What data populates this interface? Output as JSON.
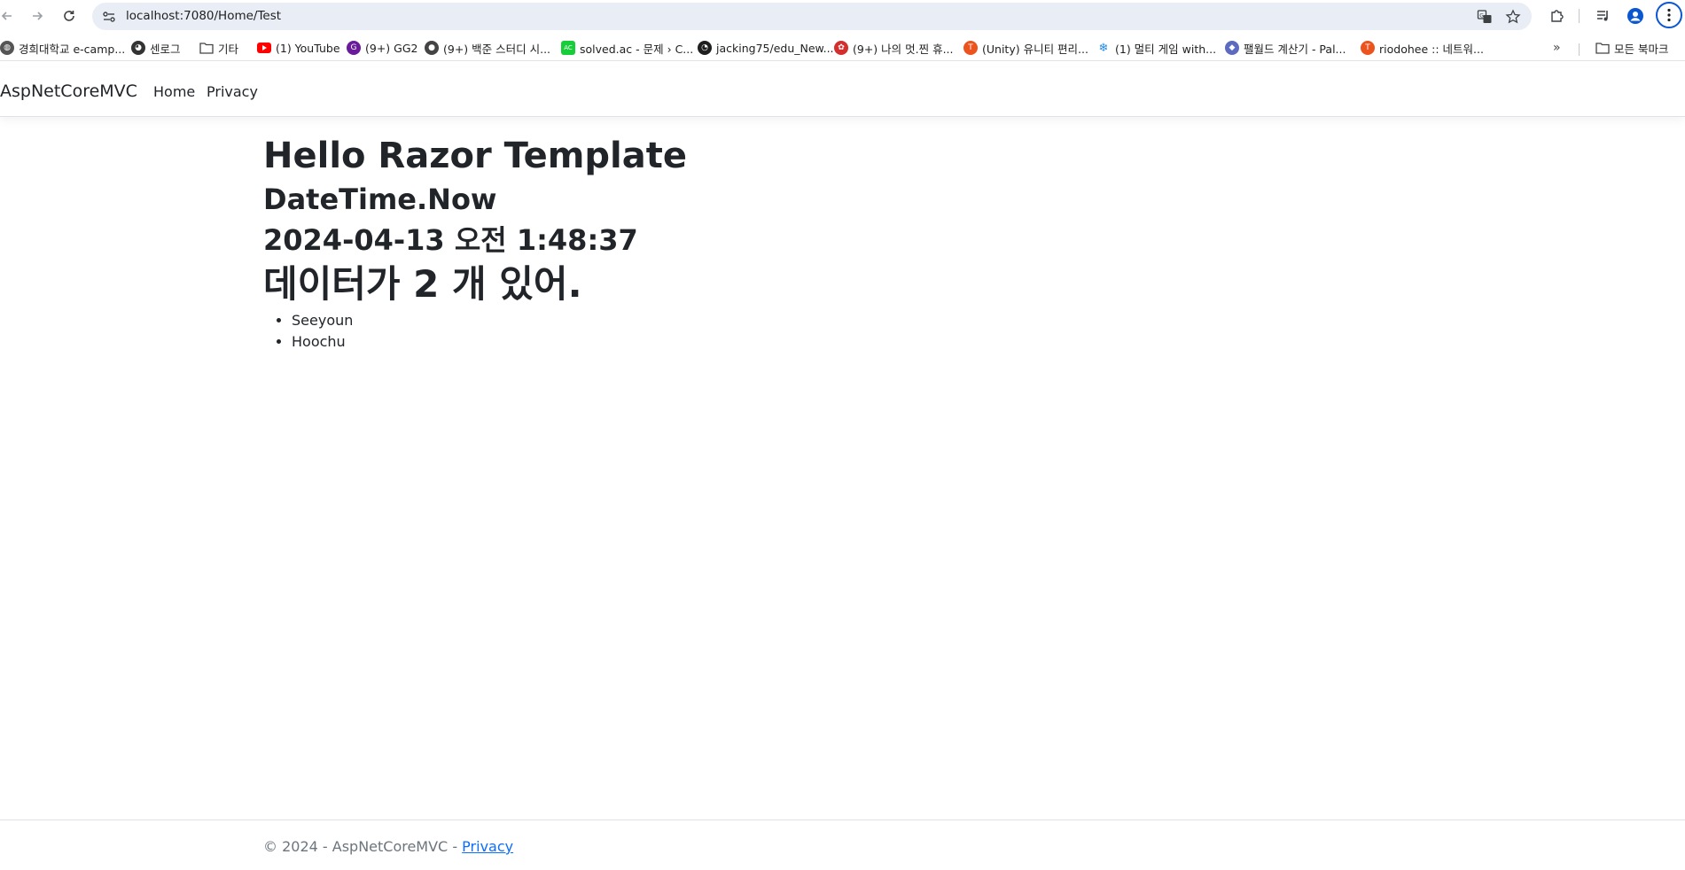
{
  "browser": {
    "url": "localhost:7080/Home/Test",
    "bookmarks": [
      {
        "label": "경희대학교 e-camp...",
        "icon": "globe-icon",
        "color": "#555555"
      },
      {
        "label": "센로그",
        "icon": "cat-icon",
        "color": "#333333"
      },
      {
        "label": "기타",
        "icon": "folder-icon",
        "color": "#444444"
      },
      {
        "label": "(1) YouTube",
        "icon": "youtube-icon",
        "color": "#ff0000"
      },
      {
        "label": "(9+) GG2",
        "icon": "gg2-icon",
        "color": "#6a1b9a"
      },
      {
        "label": "(9+) 백준 스터디 시...",
        "icon": "panda-icon",
        "color": "#444444"
      },
      {
        "label": "solved.ac - 문제 › C...",
        "icon": "solvedac-icon",
        "color": "#17ce3a"
      },
      {
        "label": "jacking75/edu_New...",
        "icon": "github-icon",
        "color": "#1f1f1f"
      },
      {
        "label": "(9+) 나의 멋.찐 휴...",
        "icon": "ribbon-icon",
        "color": "#d32f2f"
      },
      {
        "label": "(Unity) 유니티 편리...",
        "icon": "tistory-icon",
        "color": "#eb531f"
      },
      {
        "label": "(1) 멀티 게임 with...",
        "icon": "snowflake-icon",
        "color": "#1e88e5"
      },
      {
        "label": "팰월드 계산기 - Pal...",
        "icon": "fish-icon",
        "color": "#5c6bc0"
      },
      {
        "label": "riodohee :: 네트워...",
        "icon": "tistory-icon",
        "color": "#eb531f"
      }
    ],
    "all_bookmarks_label": "모든 북마크"
  },
  "app": {
    "brand": "AspNetCoreMVC",
    "nav": [
      "Home",
      "Privacy"
    ]
  },
  "content": {
    "title": "Hello Razor Template",
    "datetime_label": "DateTime.Now",
    "datetime_value": "2024-04-13 오전 1:48:37",
    "count_text": "데이터가 2 개 있어.",
    "items": [
      "Seeyoun",
      "Hoochu"
    ]
  },
  "footer": {
    "text": "© 2024 - AspNetCoreMVC - ",
    "link": "Privacy"
  }
}
